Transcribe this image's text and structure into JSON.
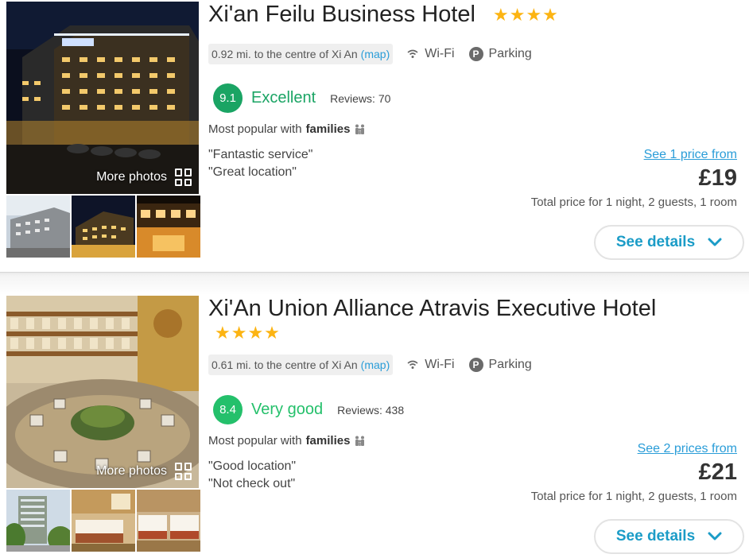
{
  "colors": {
    "star": "#fcb413",
    "link": "#2a9dd8",
    "button_text": "#1b9cc7",
    "excellent": "#1aa464",
    "very_good": "#24c06b"
  },
  "hotels": [
    {
      "name": "Xi'an Feilu Business Hotel",
      "stars": "★★★★",
      "more_photos": "More photos",
      "distance": "0.92 mi. to the centre of Xi An",
      "map_label": "(map)",
      "wifi": "Wi-Fi",
      "parking_icon": "P",
      "parking": "Parking",
      "score": "9.1",
      "rating_word": "Excellent",
      "reviews": "Reviews: 70",
      "popular_prefix": "Most popular with",
      "popular_group": "families",
      "quotes": [
        "\"Fantastic service\"",
        "\"Great location\""
      ],
      "see_prices": "See 1 price from",
      "price": "£19",
      "total": "Total price for 1 night, 2 guests, 1 room",
      "details": "See details"
    },
    {
      "name": "Xi'An Union Alliance Atravis Executive Hotel",
      "stars": "★★★★",
      "more_photos": "More photos",
      "distance": "0.61 mi. to the centre of Xi An",
      "map_label": "(map)",
      "wifi": "Wi-Fi",
      "parking_icon": "P",
      "parking": "Parking",
      "score": "8.4",
      "rating_word": "Very good",
      "reviews": "Reviews: 438",
      "popular_prefix": "Most popular with",
      "popular_group": "families",
      "quotes": [
        "\"Good location\"",
        "\"Not check out\""
      ],
      "see_prices": "See 2 prices from",
      "price": "£21",
      "total": "Total price for 1 night, 2 guests, 1 room",
      "details": "See details"
    }
  ]
}
